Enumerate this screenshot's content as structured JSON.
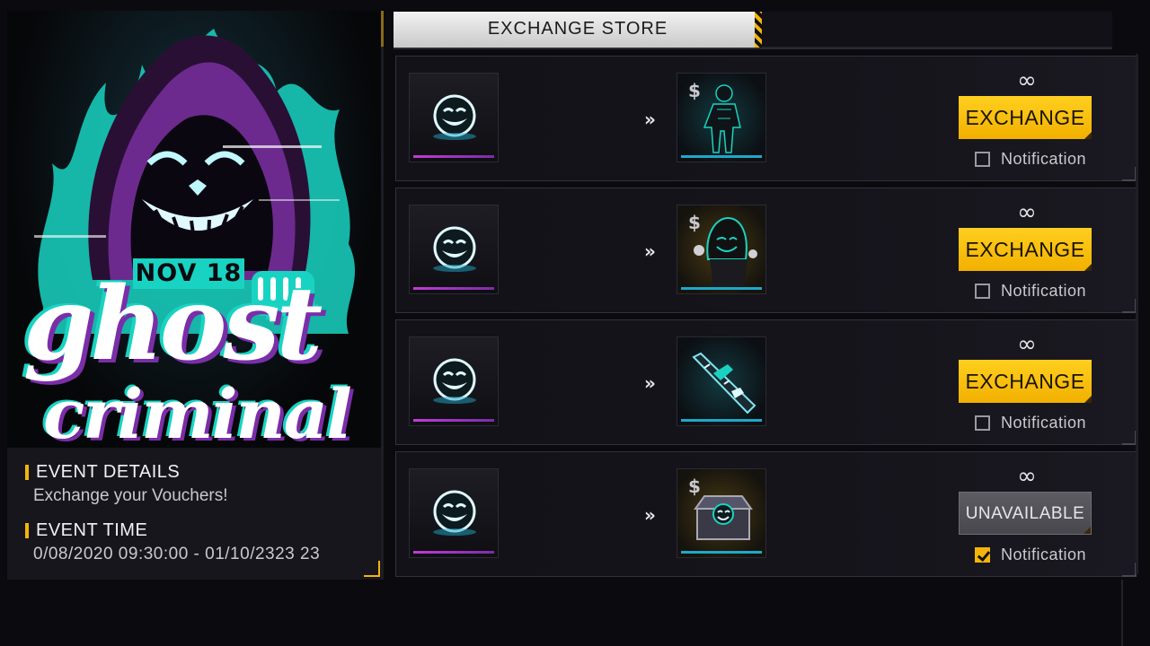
{
  "banner": {
    "date": "NOV 18",
    "title": "ghost",
    "subtitle": "criminal"
  },
  "event": {
    "details_heading": "EVENT DETAILS",
    "details_text": "Exchange your Vouchers!",
    "time_heading": "EVENT TIME",
    "time_text": "0/08/2020 09:30:00 - 01/10/2323 23"
  },
  "store": {
    "tab_label": "EXCHANGE STORE",
    "arrow_glyph": "»",
    "rows": [
      {
        "stock": "∞",
        "button": "EXCHANGE",
        "notification": "Notification",
        "reward_icon": "ghost-criminal-bundle-icon"
      },
      {
        "stock": "∞",
        "button": "EXCHANGE",
        "notification": "Notification",
        "reward_icon": "hooded-ghost-outfit-icon"
      },
      {
        "stock": "∞",
        "button": "EXCHANGE",
        "notification": "Notification",
        "reward_icon": "ghost-gun-skin-icon"
      },
      {
        "stock": "∞",
        "button": "UNAVAILABLE",
        "notification": "Notification",
        "reward_icon": "ghost-loot-box-icon"
      }
    ]
  },
  "colors": {
    "accent_yellow": "#f5b40a",
    "teal": "#19d3c2",
    "purple": "#7a2ea8",
    "disabled_gray": "#55555b"
  }
}
